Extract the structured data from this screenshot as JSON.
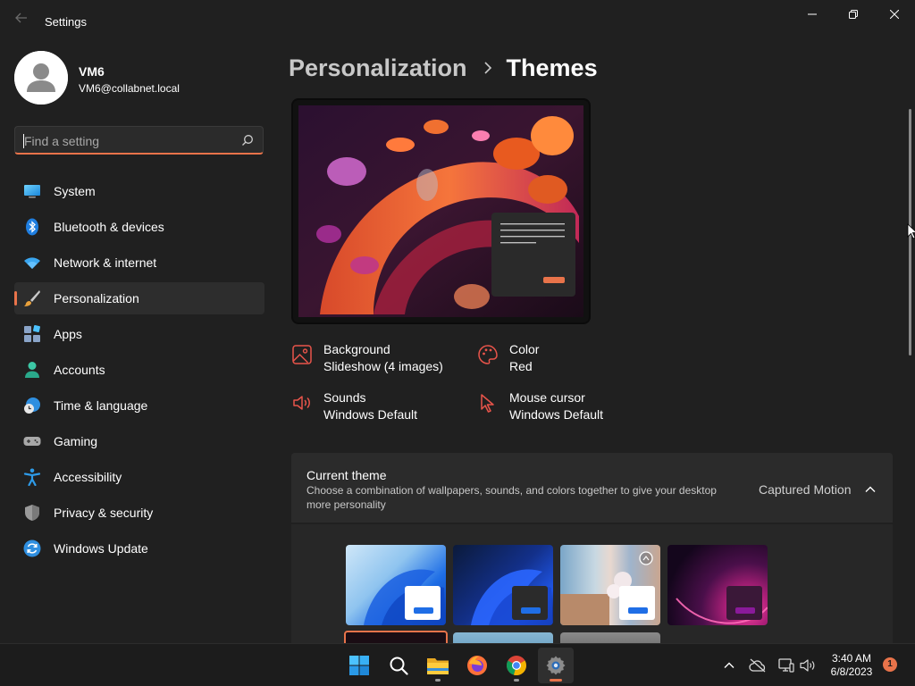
{
  "window": {
    "title": "Settings"
  },
  "user": {
    "name": "VM6",
    "email": "VM6@collabnet.local"
  },
  "search": {
    "placeholder": "Find a setting",
    "value": ""
  },
  "sidebar": {
    "items": [
      {
        "label": "System",
        "icon": "system-icon"
      },
      {
        "label": "Bluetooth & devices",
        "icon": "bluetooth-icon"
      },
      {
        "label": "Network & internet",
        "icon": "wifi-icon"
      },
      {
        "label": "Personalization",
        "icon": "brush-icon",
        "active": true
      },
      {
        "label": "Apps",
        "icon": "apps-icon"
      },
      {
        "label": "Accounts",
        "icon": "accounts-icon"
      },
      {
        "label": "Time & language",
        "icon": "clock-globe-icon"
      },
      {
        "label": "Gaming",
        "icon": "gamepad-icon"
      },
      {
        "label": "Accessibility",
        "icon": "accessibility-icon"
      },
      {
        "label": "Privacy & security",
        "icon": "shield-icon"
      },
      {
        "label": "Windows Update",
        "icon": "update-icon"
      }
    ]
  },
  "breadcrumb": {
    "parent": "Personalization",
    "current": "Themes"
  },
  "theme_props": {
    "background": {
      "title": "Background",
      "value": "Slideshow (4 images)",
      "icon": "image-icon"
    },
    "color": {
      "title": "Color",
      "value": "Red",
      "icon": "palette-icon"
    },
    "sounds": {
      "title": "Sounds",
      "value": "Windows Default",
      "icon": "speaker-icon"
    },
    "cursor": {
      "title": "Mouse cursor",
      "value": "Windows Default",
      "icon": "cursor-icon"
    }
  },
  "current_theme": {
    "title": "Current theme",
    "description": "Choose a combination of wallpapers, sounds, and colors together to give your desktop more personality",
    "value": "Captured Motion"
  },
  "taskbar": {
    "apps": [
      "start-icon",
      "search-icon",
      "file-explorer-icon",
      "firefox-icon",
      "chrome-icon",
      "settings-icon"
    ],
    "time": "3:40 AM",
    "date": "6/8/2023",
    "notifications": "1"
  },
  "colors": {
    "accent": "#e8734a",
    "window_bg": "#202020",
    "card_bg": "#2b2b2b",
    "taskbar_bg": "#1c1c1c"
  }
}
